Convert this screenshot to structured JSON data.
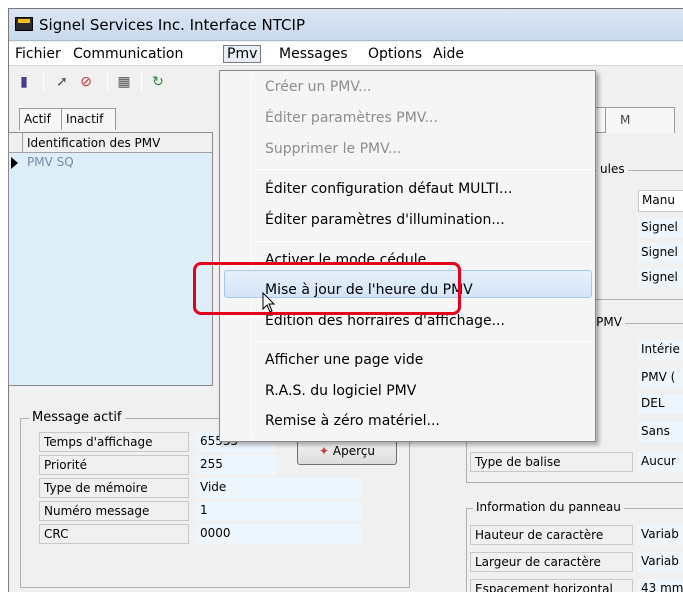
{
  "window": {
    "title": "Signel Services Inc. Interface NTCIP"
  },
  "menubar": [
    "Fichier",
    "Communication",
    "Pmv",
    "Messages",
    "Options",
    "Aide"
  ],
  "toolbar": {
    "icons": [
      "door-icon",
      "wrench-icon",
      "no-entry-icon",
      "device-icon",
      "refresh-icon"
    ]
  },
  "left": {
    "tabs": [
      "Actif",
      "Inactif"
    ],
    "grid_header": "Identification des PMV",
    "rows": [
      "PMV SQ"
    ]
  },
  "message": {
    "legend": "Message actif",
    "fields": [
      {
        "label": "Temps d'affichage",
        "value": "65535"
      },
      {
        "label": "Priorité",
        "value": "255"
      },
      {
        "label": "Type de mémoire",
        "value": "Vide"
      },
      {
        "label": "Numéro message",
        "value": "1"
      },
      {
        "label": "CRC",
        "value": "0000"
      }
    ],
    "preview_button": "Aperçu"
  },
  "right": {
    "tab2": "M",
    "group1_legend": "ules",
    "group1_values": [
      "Manu",
      "Signel",
      "Signel",
      "Signel"
    ],
    "group2_legend": "eau PMV",
    "group2_values": [
      "Intérie",
      "PMV (",
      "DEL",
      "Sans"
    ],
    "balise_label": "Type de balise",
    "balise_value": "Aucur",
    "group3_legend": "Information du panneau",
    "panel_fields": [
      {
        "label": "Hauteur de caractère",
        "value": "Variab"
      },
      {
        "label": "Largeur de caractère",
        "value": "Variab"
      },
      {
        "label": "Espacement horizontal",
        "value": "43 mm"
      }
    ]
  },
  "dropdown": {
    "items": [
      {
        "label": "Créer un PMV...",
        "disabled": true
      },
      {
        "label": "Éditer paramètres PMV...",
        "disabled": true
      },
      {
        "label": "Supprimer le PMV...",
        "disabled": true
      },
      {
        "label": "Éditer configuration défaut MULTI...",
        "disabled": false
      },
      {
        "label": "Éditer paramètres d'illumination...",
        "disabled": false
      },
      {
        "label": "Activer le mode cédule",
        "disabled": false
      },
      {
        "label": "Mise à jour de l'heure du PMV",
        "disabled": false
      },
      {
        "label": "Édition des horraires d'affichage...",
        "disabled": false
      },
      {
        "label": "Afficher une page vide",
        "disabled": false
      },
      {
        "label": "R.A.S. du logiciel PMV",
        "disabled": false
      },
      {
        "label": "Remise à zéro matériel...",
        "disabled": false
      }
    ],
    "highlighted_index": 6
  },
  "colors": {
    "highlight_border": "#e4001b",
    "menu_hover": "#d4e4f7"
  }
}
